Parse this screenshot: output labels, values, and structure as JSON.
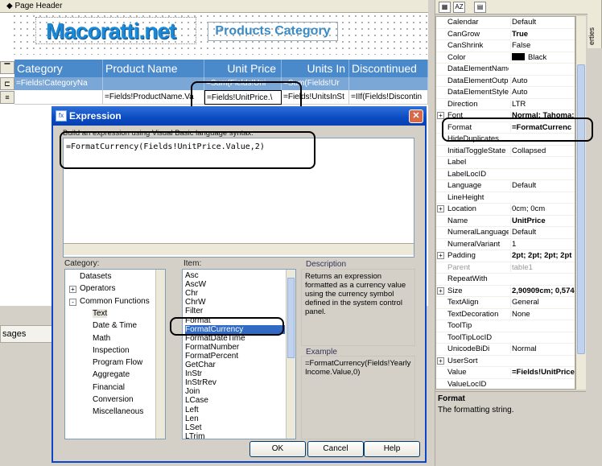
{
  "designer": {
    "page_header_label": "Page Header",
    "logo_text": "Macoratti.net",
    "report_title": "Products Category",
    "table_headers": [
      "Category",
      "Product Name",
      "Unit Price",
      "Units In",
      "Discontinued"
    ],
    "group_row": [
      "=Fields!CategoryNa",
      "",
      "=Sum(Fields!Uni",
      "=Sum(Fields!Ur",
      ""
    ],
    "detail_row": [
      "",
      "=Fields!ProductName.Va",
      "=Fields!UnitPrice.\\",
      "=Fields!UnitsInSt",
      "=IIf(Fields!Discontin"
    ]
  },
  "bottom": {
    "messages_tab": "sages"
  },
  "properties": {
    "side_tab": "erties",
    "rows": [
      {
        "name": "Calendar",
        "value": "Default"
      },
      {
        "name": "CanGrow",
        "value": "True",
        "bold": true
      },
      {
        "name": "CanShrink",
        "value": "False"
      },
      {
        "name": "Color",
        "value": "Black",
        "swatch": true
      },
      {
        "name": "DataElementName",
        "value": ""
      },
      {
        "name": "DataElementOutp",
        "value": "Auto"
      },
      {
        "name": "DataElementStyle",
        "value": "Auto"
      },
      {
        "name": "Direction",
        "value": "LTR"
      },
      {
        "name": "Font",
        "value": "Normal; Tahoma;",
        "bold": true,
        "expand": true
      },
      {
        "name": "Format",
        "value": "=FormatCurrenc",
        "bold": true
      },
      {
        "name": "HideDuplicates",
        "value": ""
      },
      {
        "name": "InitialToggleState",
        "value": "Collapsed"
      },
      {
        "name": "Label",
        "value": ""
      },
      {
        "name": "LabelLocID",
        "value": ""
      },
      {
        "name": "Language",
        "value": "Default"
      },
      {
        "name": "LineHeight",
        "value": ""
      },
      {
        "name": "Location",
        "value": "0cm; 0cm",
        "expand": true
      },
      {
        "name": "Name",
        "value": "UnitPrice",
        "bold": true
      },
      {
        "name": "NumeralLanguage",
        "value": "Default"
      },
      {
        "name": "NumeralVariant",
        "value": "1"
      },
      {
        "name": "Padding",
        "value": "2pt; 2pt; 2pt; 2pt",
        "bold": true,
        "expand": true
      },
      {
        "name": "Parent",
        "value": "table1",
        "grey": true
      },
      {
        "name": "RepeatWith",
        "value": ""
      },
      {
        "name": "Size",
        "value": "2,90909cm; 0,574",
        "bold": true,
        "expand": true
      },
      {
        "name": "TextAlign",
        "value": "General"
      },
      {
        "name": "TextDecoration",
        "value": "None"
      },
      {
        "name": "ToolTip",
        "value": ""
      },
      {
        "name": "ToolTipLocID",
        "value": ""
      },
      {
        "name": "UnicodeBiDi",
        "value": "Normal"
      },
      {
        "name": "UserSort",
        "value": "",
        "expand": true
      },
      {
        "name": "Value",
        "value": "=Fields!UnitPrice",
        "bold": true
      },
      {
        "name": "ValueLocID",
        "value": ""
      }
    ],
    "desc_title": "Format",
    "desc_text": "The formatting string."
  },
  "dialog": {
    "title": "Expression",
    "hint": "Build an expression using Visual Basic language syntax:",
    "expression": "=FormatCurrency(Fields!UnitPrice.Value,2)",
    "category_label": "Category:",
    "item_label": "Item:",
    "description_label": "Description",
    "example_label": "Example",
    "categories": [
      {
        "label": "Datasets",
        "indent": 0,
        "expander": ""
      },
      {
        "label": "Operators",
        "indent": 0,
        "expander": "+"
      },
      {
        "label": "Common Functions",
        "indent": 0,
        "expander": "-"
      },
      {
        "label": "Text",
        "indent": 1,
        "expander": "",
        "selected": true
      },
      {
        "label": "Date & Time",
        "indent": 1,
        "expander": ""
      },
      {
        "label": "Math",
        "indent": 1,
        "expander": ""
      },
      {
        "label": "Inspection",
        "indent": 1,
        "expander": ""
      },
      {
        "label": "Program Flow",
        "indent": 1,
        "expander": ""
      },
      {
        "label": "Aggregate",
        "indent": 1,
        "expander": ""
      },
      {
        "label": "Financial",
        "indent": 1,
        "expander": ""
      },
      {
        "label": "Conversion",
        "indent": 1,
        "expander": ""
      },
      {
        "label": "Miscellaneous",
        "indent": 1,
        "expander": ""
      }
    ],
    "items": [
      "Asc",
      "AscW",
      "Chr",
      "ChrW",
      "Filter",
      "Format",
      "FormatCurrency",
      "FormatDateTime",
      "FormatNumber",
      "FormatPercent",
      "GetChar",
      "InStr",
      "InStrRev",
      "Join",
      "LCase",
      "Left",
      "Len",
      "LSet",
      "LTrim"
    ],
    "selected_item": "FormatCurrency",
    "description": "Returns an expression formatted as a currency value using the currency symbol defined in the system control panel.",
    "example": "=FormatCurrency(Fields!YearlyIncome.Value,0)",
    "buttons": {
      "ok": "OK",
      "cancel": "Cancel",
      "help": "Help"
    }
  }
}
